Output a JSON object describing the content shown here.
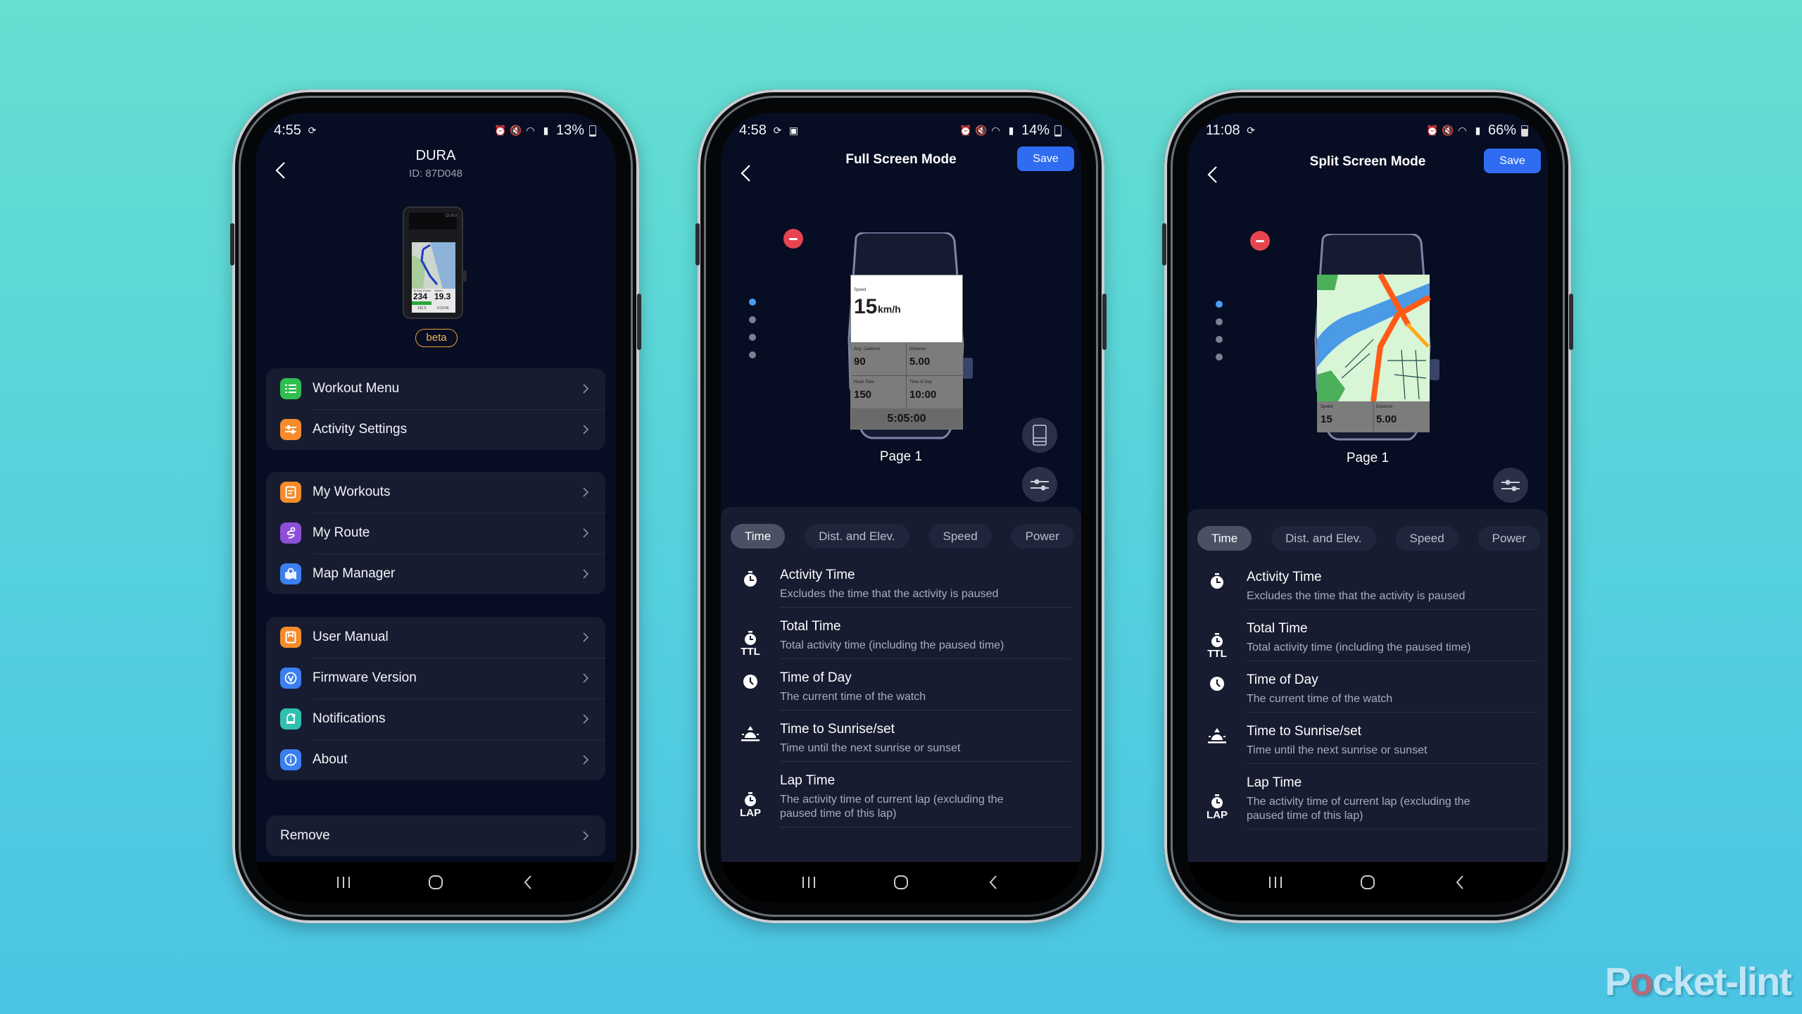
{
  "background": {
    "top_color": "#66dfd0",
    "bottom_color": "#4bc4e4"
  },
  "watermark": {
    "prefix": "P",
    "o": "o",
    "suffix": "cket-lint",
    "full": "Pocket-lint"
  },
  "colors": {
    "accent_blue": "#2f6cf2",
    "delete_red": "#e64550",
    "beta_orange": "#e9a43a",
    "screen_bg": "#070d22",
    "card_bg": "#171c31"
  },
  "phones": [
    {
      "status": {
        "time": "4:55",
        "battery": "13%",
        "battery_level": 0.13,
        "charging": true,
        "icons": [
          "sync-icon",
          "alarm-icon",
          "mute-icon",
          "wifi-icon",
          "signal-icon"
        ]
      },
      "header": {
        "title": "DURA",
        "subtitle": "ID: 87D048"
      },
      "device_preview": {
        "brand_label": "DURA",
        "field1_label": "3s Avg. Power",
        "field1_value": "234",
        "field2_label": "Speed",
        "field2_value": "19.3",
        "footer_left": "152.5",
        "footer_right": "0:23:46"
      },
      "badge": "beta",
      "menu_groups": [
        [
          {
            "label": "Workout Menu",
            "icon": "list-icon",
            "color": "#2fbe4f"
          },
          {
            "label": "Activity Settings",
            "icon": "sliders-icon",
            "color": "#f58b2a"
          }
        ],
        [
          {
            "label": "My Workouts",
            "icon": "document-icon",
            "color": "#f58b2a"
          },
          {
            "label": "My Route",
            "icon": "route-icon",
            "color": "#8e4fd8"
          },
          {
            "label": "Map Manager",
            "icon": "map-pin-icon",
            "color": "#3b7ff0"
          }
        ],
        [
          {
            "label": "User Manual",
            "icon": "book-icon",
            "color": "#f58b2a"
          },
          {
            "label": "Firmware Version",
            "icon": "firmware-icon",
            "color": "#3b7ff0"
          },
          {
            "label": "Notifications",
            "icon": "bell-icon",
            "color": "#2fc0b2"
          },
          {
            "label": "About",
            "icon": "info-icon",
            "color": "#3b7ff0"
          }
        ],
        [
          {
            "label": "Remove"
          }
        ]
      ]
    },
    {
      "status": {
        "time": "4:58",
        "battery": "14%",
        "battery_level": 0.14,
        "charging": true,
        "icons": [
          "sync-icon",
          "gallery-icon",
          "alarm-icon",
          "mute-icon",
          "wifi-icon",
          "signal-icon"
        ]
      },
      "header": {
        "title": "Full Screen Mode",
        "save_label": "Save"
      },
      "pager": {
        "pages": 4,
        "active": 1
      },
      "device_screen": {
        "main_label": "Speed",
        "main_value": "15",
        "main_unit": "km/h",
        "cells": [
          {
            "label": "Avg. Cadence",
            "value": "90"
          },
          {
            "label": "Distance",
            "value": "5.00"
          },
          {
            "label": "Heart Rate",
            "value": "150"
          },
          {
            "label": "Time of Day",
            "value": "10:00"
          }
        ],
        "footer_value": "5:05:00"
      },
      "page_label": "Page 1",
      "tabs": [
        "Time",
        "Dist. and Elev.",
        "Speed",
        "Power"
      ],
      "active_tab": 0,
      "fields": [
        {
          "title": "Activity Time",
          "desc": "Excludes the time that the activity is paused",
          "icon": "stopwatch-icon"
        },
        {
          "title": "Total Time",
          "desc": "Total activity time (including the paused time)",
          "icon": "stopwatch-ttl-icon",
          "icon_text": "TTL"
        },
        {
          "title": "Time of Day",
          "desc": "The current time of the watch",
          "icon": "clock-icon"
        },
        {
          "title": "Time to Sunrise/set",
          "desc": "Time until the next sunrise or sunset",
          "icon": "sunrise-icon"
        },
        {
          "title": "Lap Time",
          "desc": "The activity time of current lap (excluding the paused time of this lap)",
          "icon": "stopwatch-lap-icon",
          "icon_text": "LAP"
        }
      ]
    },
    {
      "status": {
        "time": "11:08",
        "battery": "66%",
        "battery_level": 0.66,
        "charging": false,
        "icons": [
          "sync-icon",
          "alarm-icon",
          "mute-icon",
          "wifi-icon",
          "signal-icon"
        ]
      },
      "header": {
        "title": "Split Screen Mode",
        "save_label": "Save"
      },
      "pager": {
        "pages": 4,
        "active": 1
      },
      "device_screen": {
        "cells": [
          {
            "label": "Speed",
            "value": "15"
          },
          {
            "label": "Distance",
            "value": "5.00"
          }
        ]
      },
      "page_label": "Page 1",
      "tabs": [
        "Time",
        "Dist. and Elev.",
        "Speed",
        "Power"
      ],
      "active_tab": 0,
      "fields": [
        {
          "title": "Activity Time",
          "desc": "Excludes the time that the activity is paused",
          "icon": "stopwatch-icon"
        },
        {
          "title": "Total Time",
          "desc": "Total activity time (including the paused time)",
          "icon": "stopwatch-ttl-icon",
          "icon_text": "TTL"
        },
        {
          "title": "Time of Day",
          "desc": "The current time of the watch",
          "icon": "clock-icon"
        },
        {
          "title": "Time to Sunrise/set",
          "desc": "Time until the next sunrise or sunset",
          "icon": "sunrise-icon"
        },
        {
          "title": "Lap Time",
          "desc": "The activity time of current lap (excluding the paused time of this lap)",
          "icon": "stopwatch-lap-icon",
          "icon_text": "LAP"
        }
      ]
    }
  ]
}
